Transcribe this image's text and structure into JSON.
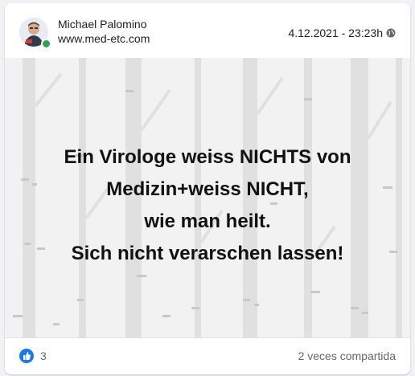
{
  "post": {
    "author_name": "Michael Palomino",
    "author_subtitle": "www.med-etc.com",
    "timestamp": "4.12.2021 - 23:23h",
    "privacy_icon": "globe-icon",
    "text_lines": [
      "Ein Virologe weiss NICHTS von",
      "Medizin+weiss NICHT,",
      "wie man heilt.",
      "Sich nicht verarschen lassen!"
    ],
    "reactions": {
      "icon": "thumbs-up-icon",
      "count": "3",
      "shares": "2 veces compartida"
    }
  },
  "colors": {
    "accent": "#1877f2",
    "online": "#31a24c",
    "image_background": "#f2f2f2",
    "tree_trunks": "#dedede"
  }
}
